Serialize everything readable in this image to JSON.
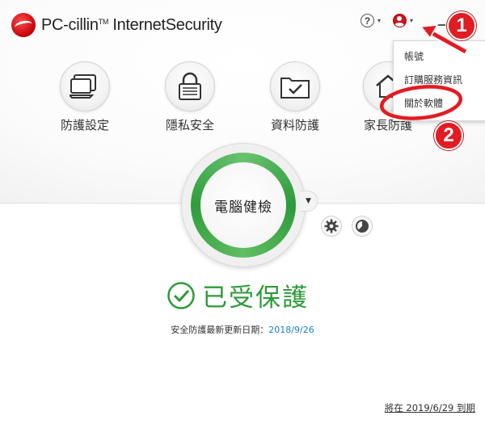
{
  "header": {
    "brand_prefix": "PC-cillin",
    "brand_tm": "TM",
    "brand_suffix": "InternetSecurity",
    "help_symbol": "?",
    "caret": "▾"
  },
  "user_menu": {
    "items": [
      {
        "label": "帳號"
      },
      {
        "label": "訂購服務資訊"
      },
      {
        "label": "關於軟體"
      }
    ]
  },
  "features": [
    {
      "label": "防護設定",
      "icon": "laptop-icon"
    },
    {
      "label": "隱私安全",
      "icon": "lock-icon"
    },
    {
      "label": "資料防護",
      "icon": "folder-check-icon"
    },
    {
      "label": "家長防護",
      "icon": "home-icon"
    }
  ],
  "scan": {
    "label": "電腦健檢",
    "dropdown_caret": "▼"
  },
  "status": {
    "label": "已受保護",
    "update_prefix": "安全防護最新更新日期：",
    "update_date": "2018/9/26",
    "expiry": "將在 2019/6/29 到期"
  },
  "annotations": {
    "step1": "1",
    "step2": "2"
  },
  "colors": {
    "brand_red": "#d0121b",
    "protected_green": "#2d9a3a",
    "scan_ring_green": "#4caf50",
    "link_blue": "#1a7fbf",
    "annotation_red": "#e21c23"
  }
}
